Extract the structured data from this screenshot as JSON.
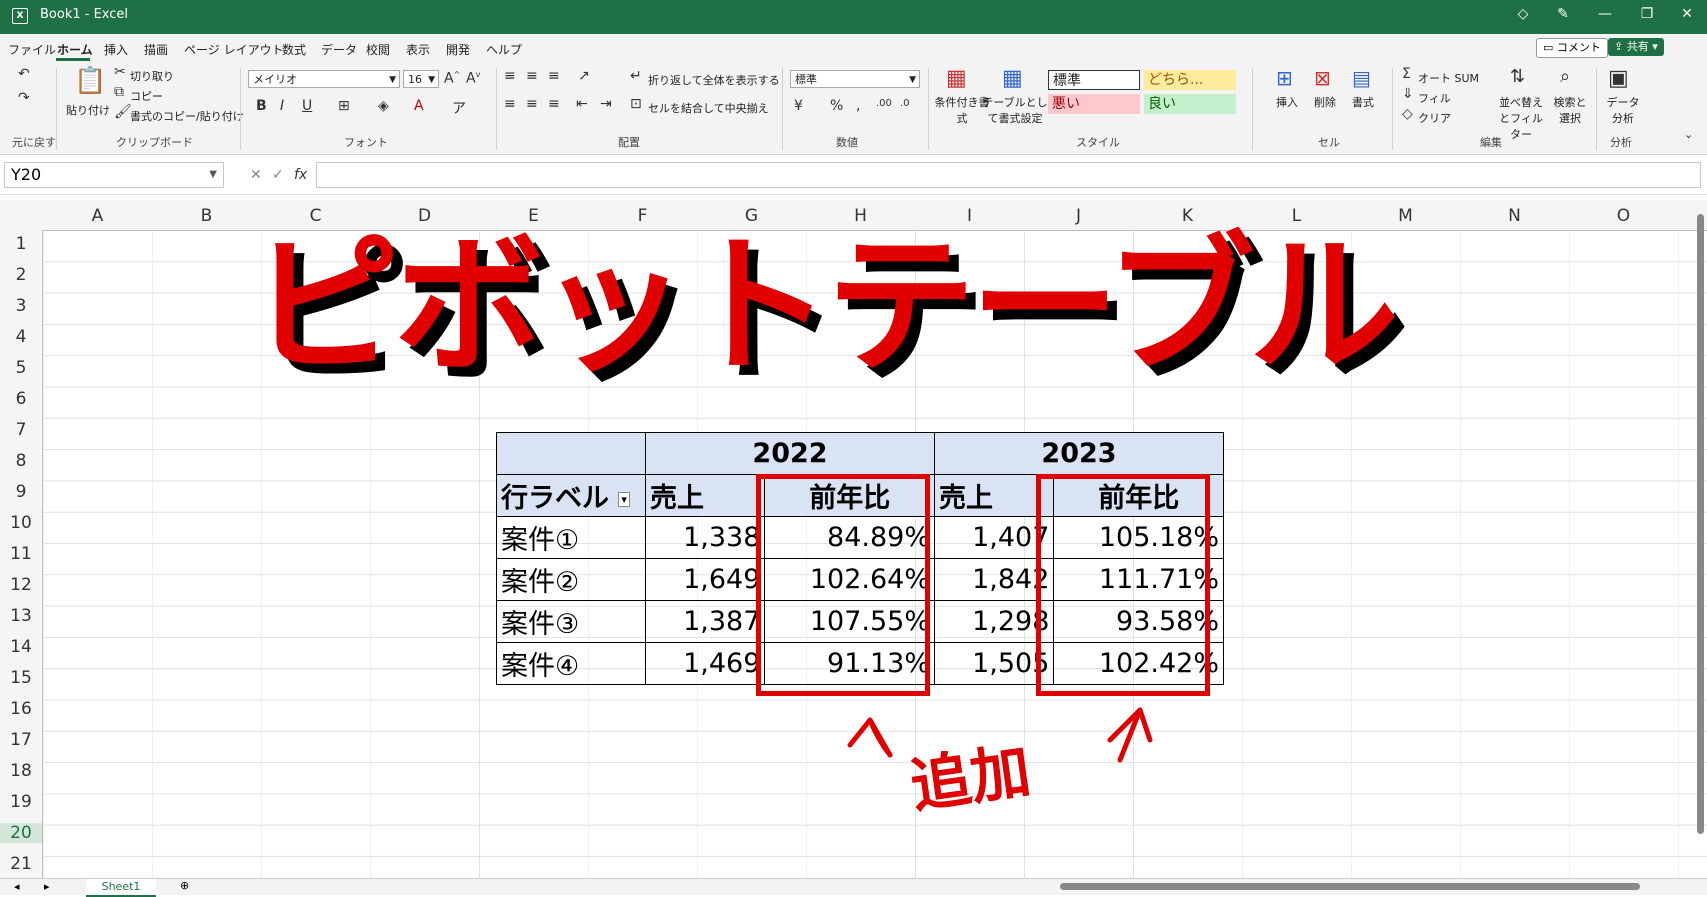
{
  "window": {
    "title": "Book1  -  Excel"
  },
  "menu": {
    "tabs": [
      "ファイル",
      "ホーム",
      "挿入",
      "描画",
      "ページ レイアウト",
      "数式",
      "データ",
      "校閲",
      "表示",
      "開発",
      "ヘルプ"
    ],
    "active": "ホーム",
    "comment_label": "コメント",
    "share_label": "共有"
  },
  "ribbon": {
    "undo_group": "元に戻す",
    "clipboard": {
      "paste": "貼り付け",
      "cut": "切り取り",
      "copy": "コピー",
      "format_painter": "書式のコピー/貼り付け",
      "group": "クリップボード"
    },
    "font": {
      "name": "メイリオ",
      "size": "16",
      "group": "フォント"
    },
    "alignment": {
      "wrap": "折り返して全体を表示する",
      "merge": "セルを結合して中央揃え",
      "group": "配置"
    },
    "number": {
      "format": "標準",
      "group": "数値"
    },
    "styles": {
      "conditional": "条件付き書式",
      "table": "テーブルとして書式設定",
      "normal": "標準",
      "neutral": "どちら...",
      "bad": "悪い",
      "good": "良い",
      "group": "スタイル"
    },
    "cells": {
      "insert": "挿入",
      "delete": "削除",
      "format": "書式",
      "group": "セル"
    },
    "editing": {
      "autosum": "オート SUM",
      "fill": "フィル",
      "clear": "クリア",
      "sort": "並べ替えとフィルター",
      "find": "検索と選択",
      "group": "編集"
    },
    "analysis": {
      "data": "データ分析",
      "group": "分析"
    }
  },
  "formula_bar": {
    "name_box": "Y20",
    "fx": "fx",
    "value": ""
  },
  "columns": [
    "A",
    "B",
    "C",
    "D",
    "E",
    "F",
    "G",
    "H",
    "I",
    "J",
    "K",
    "L",
    "M",
    "N",
    "O"
  ],
  "rows": [
    "1",
    "2",
    "3",
    "4",
    "5",
    "6",
    "7",
    "8",
    "9",
    "10",
    "11",
    "12",
    "13",
    "14",
    "15",
    "16",
    "17",
    "18",
    "19",
    "20",
    "21"
  ],
  "banner": "ピボットテーブル",
  "pivot": {
    "year1": "2022",
    "year2": "2023",
    "row_label": "行ラベル",
    "sales": "売上",
    "yoy": "前年比",
    "rows": [
      {
        "label": "案件①",
        "s1": "1,338",
        "y1": "84.89%",
        "s2": "1,407",
        "y2": "105.18%"
      },
      {
        "label": "案件②",
        "s1": "1,649",
        "y1": "102.64%",
        "s2": "1,842",
        "y2": "111.71%"
      },
      {
        "label": "案件③",
        "s1": "1,387",
        "y1": "107.55%",
        "s2": "1,298",
        "y2": "93.58%"
      },
      {
        "label": "案件④",
        "s1": "1,469",
        "y1": "91.13%",
        "s2": "1,505",
        "y2": "102.42%"
      }
    ]
  },
  "annotation": "追加",
  "sheet_tab": "Sheet1"
}
